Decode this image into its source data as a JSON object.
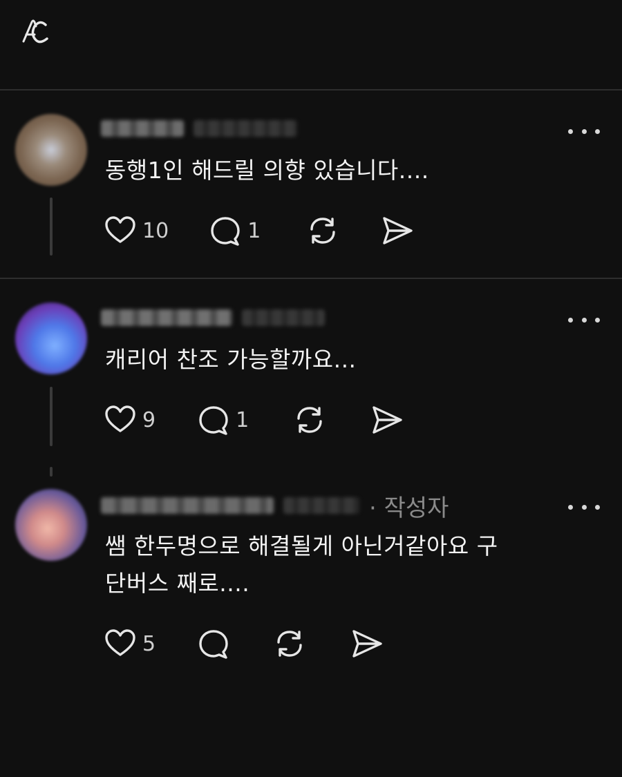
{
  "header": {
    "logo_icon": "app-logo-icon"
  },
  "colors": {
    "background": "#101010",
    "divider": "#2e2e2e",
    "text": "#f3f3f3",
    "muted": "#8a8a8a"
  },
  "comments": [
    {
      "text": "동행1인 해드릴 의향 있습니다....",
      "likes": "10",
      "replies": "1",
      "author_badge": ""
    },
    {
      "text": "캐리어 찬조 가능할까요...",
      "likes": "9",
      "replies": "1",
      "author_badge": ""
    },
    {
      "text_line1": "쌤 한두명으로 해결될게 아닌거같아요 구",
      "text_line2": "단버스 째로....",
      "likes": "5",
      "replies": "",
      "author_badge": "· 작성자"
    }
  ],
  "icons": {
    "like": "heart-icon",
    "reply": "comment-icon",
    "repost": "repost-icon",
    "share": "send-icon",
    "more": "more-dots-icon"
  }
}
